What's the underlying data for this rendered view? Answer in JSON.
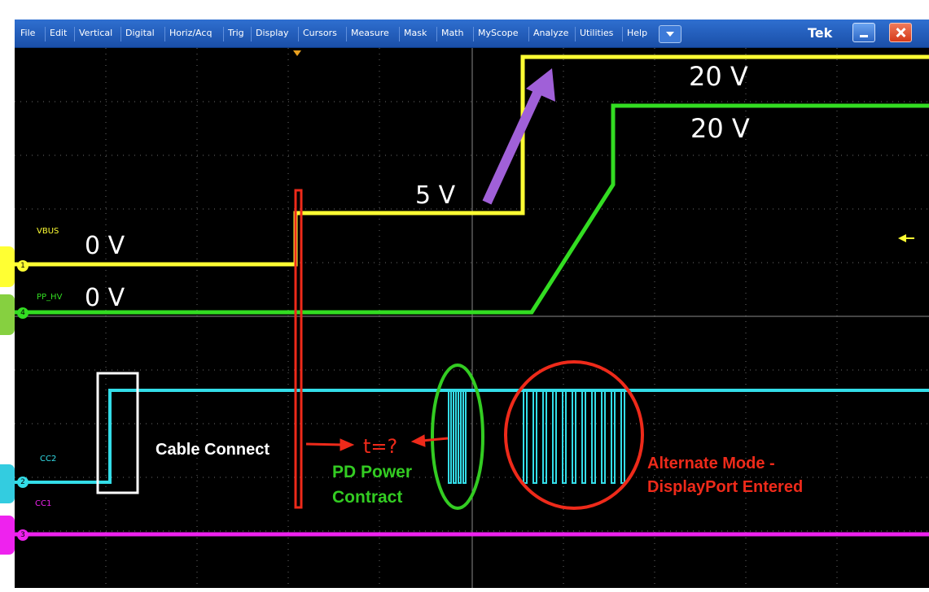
{
  "menubar": {
    "items": [
      "File",
      "Edit",
      "Vertical",
      "Digital",
      "Horiz/Acq",
      "Trig",
      "Display",
      "Cursors",
      "Measure",
      "Mask",
      "Math",
      "MyScope",
      "Analyze",
      "Utilities",
      "Help"
    ],
    "brand": "Tek"
  },
  "channels": {
    "ch1": {
      "number": "1",
      "label": "VBUS",
      "color": "#ffff33"
    },
    "ch4": {
      "number": "4",
      "label": "PP_HV",
      "color": "#33dd22"
    },
    "ch2": {
      "number": "2",
      "label": "CC2",
      "color": "#33dde8"
    },
    "ch3": {
      "number": "3",
      "label": "CC1",
      "color": "#ee22ee"
    }
  },
  "annotations": {
    "vbus_0v": "0 V",
    "pphv_0v": "0 V",
    "vbus_5v": "5 V",
    "vbus_20v": "20 V",
    "pphv_20v": "20 V",
    "cable_connect": "Cable Connect",
    "t_question": "t=?",
    "pd_contract_line1": "PD Power",
    "pd_contract_line2": "Contract",
    "alt_mode_line1": "Alternate Mode -",
    "alt_mode_line2": "DisplayPort Entered"
  },
  "colors": {
    "grid": "#777777",
    "annotation_red": "#ee2a1a",
    "annotation_green": "#33cc22",
    "annotation_purple": "#a060d8"
  }
}
